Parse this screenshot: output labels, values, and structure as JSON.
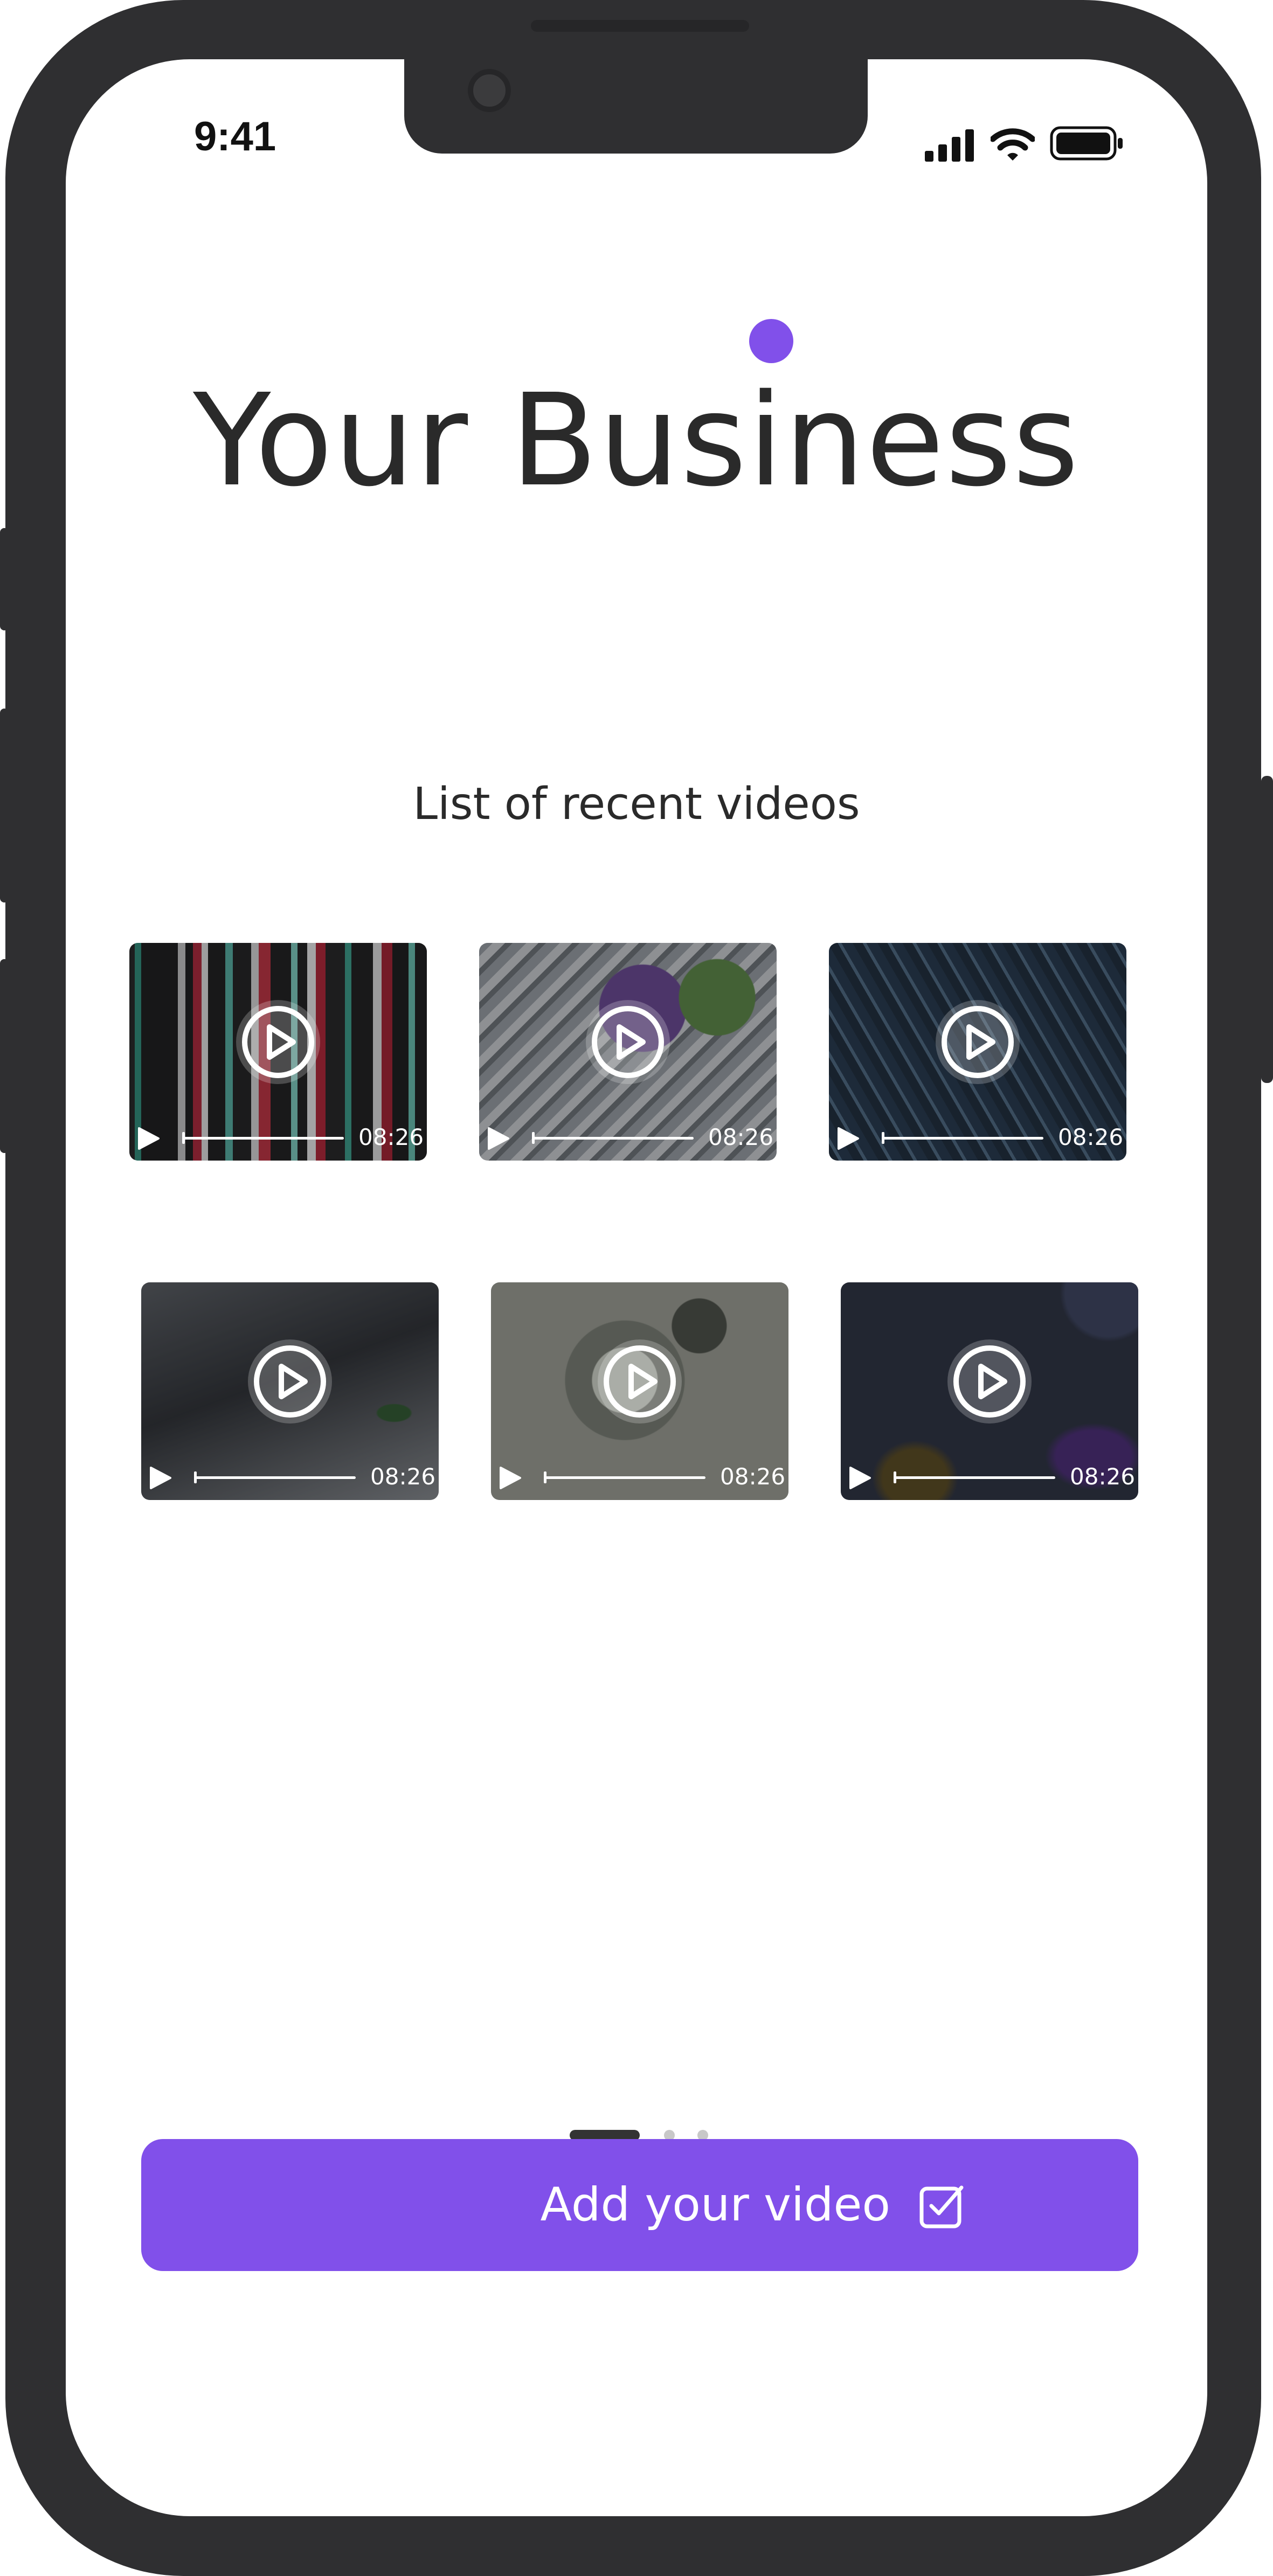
{
  "status_bar": {
    "time": "9:41"
  },
  "header": {
    "title": "Your Business",
    "accent_color": "#8150ea"
  },
  "section": {
    "subtitle": "List of recent videos"
  },
  "videos": [
    {
      "duration": "08:26",
      "theme": "neon-stripes"
    },
    {
      "duration": "08:26",
      "theme": "wireframe-sketches"
    },
    {
      "duration": "08:26",
      "theme": "dark-curves"
    },
    {
      "duration": "08:26",
      "theme": "laptop-code"
    },
    {
      "duration": "08:26",
      "theme": "bird-flowers"
    },
    {
      "duration": "08:26",
      "theme": "soft-gradient"
    }
  ],
  "pagination": {
    "total": 3,
    "active": 1
  },
  "cta": {
    "label": "Add your video",
    "icon": "checkbox-icon"
  },
  "icons": [
    "signal-icon",
    "wifi-icon",
    "battery-icon",
    "play-icon",
    "checkbox-icon"
  ]
}
